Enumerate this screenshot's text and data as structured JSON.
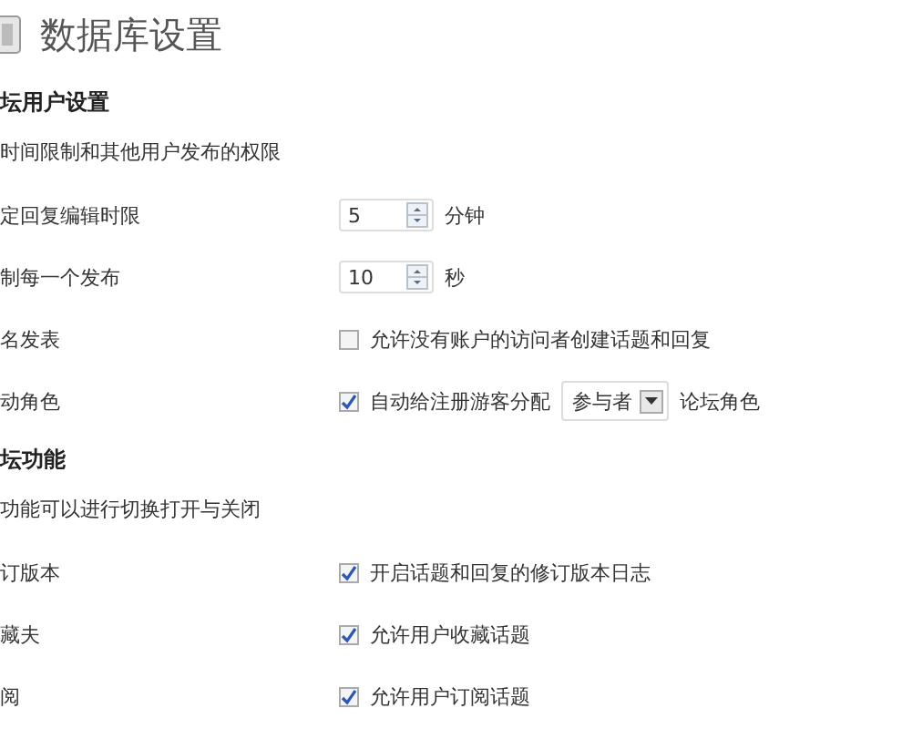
{
  "title": "数据库设置",
  "sections": [
    {
      "heading": "坛用户设置",
      "description": "时间限制和其他用户发布的权限",
      "rows": [
        {
          "label": "定回复编辑时限",
          "kind": "number",
          "value": "5",
          "unit": "分钟"
        },
        {
          "label": "制每一个发布",
          "kind": "number",
          "value": "10",
          "unit": "秒"
        },
        {
          "label": "名发表",
          "kind": "checkbox",
          "checked": false,
          "text": "允许没有账户的访问者创建话题和回复"
        },
        {
          "label": "动角色",
          "kind": "checkbox_select",
          "checked": true,
          "text": "自动给注册游客分配",
          "select": "参与者",
          "suffix": "论坛角色"
        }
      ]
    },
    {
      "heading": "坛功能",
      "description": "功能可以进行切换打开与关闭",
      "rows": [
        {
          "label": "订版本",
          "kind": "checkbox",
          "checked": true,
          "text": "开启话题和回复的修订版本日志"
        },
        {
          "label": "藏夫",
          "kind": "checkbox",
          "checked": true,
          "text": "允许用户收藏话题"
        },
        {
          "label": "阅",
          "kind": "checkbox",
          "checked": true,
          "text": "允许用户订阅话题"
        }
      ]
    }
  ]
}
